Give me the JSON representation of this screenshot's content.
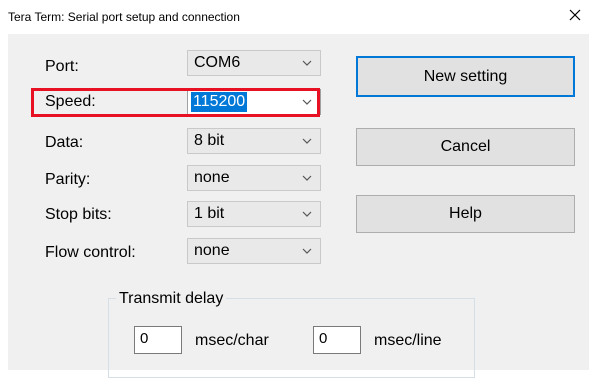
{
  "window": {
    "title": "Tera Term: Serial port setup and connection"
  },
  "fields": {
    "port": {
      "label": "Port:",
      "value": "COM6"
    },
    "speed": {
      "label": "Speed:",
      "value": "115200"
    },
    "data": {
      "label": "Data:",
      "value": "8 bit"
    },
    "parity": {
      "label": "Parity:",
      "value": "none"
    },
    "stop_bits": {
      "label": "Stop bits:",
      "value": "1 bit"
    },
    "flow": {
      "label": "Flow control:",
      "value": "none"
    }
  },
  "buttons": {
    "new_setting": "New setting",
    "cancel": "Cancel",
    "help": "Help"
  },
  "transmit_delay": {
    "caption": "Transmit delay",
    "char_value": "0",
    "char_unit": "msec/char",
    "line_value": "0",
    "line_unit": "msec/line"
  },
  "colors": {
    "annotation_box": "#e81123",
    "selection": "#0078d7"
  }
}
